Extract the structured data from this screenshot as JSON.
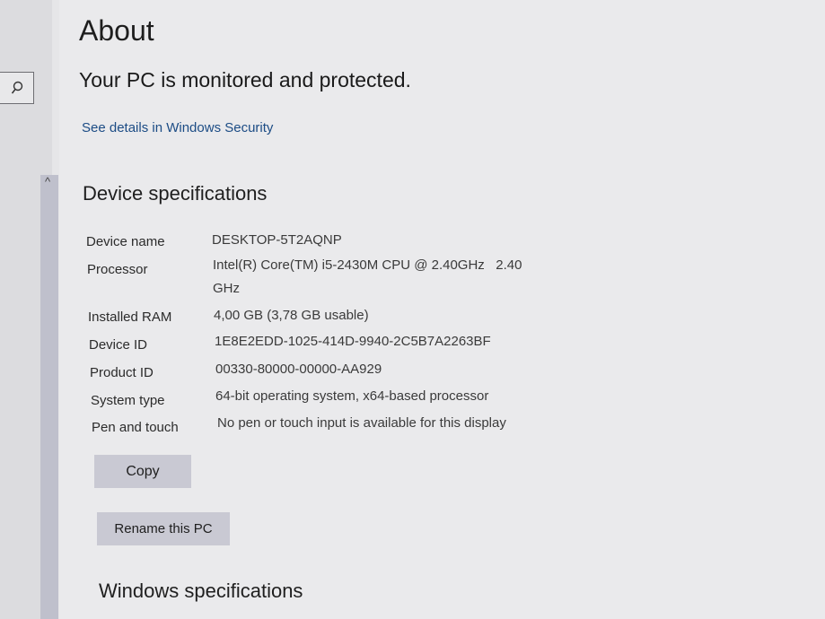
{
  "page": {
    "title": "About",
    "protection_status": "Your PC is monitored and protected.",
    "security_link": "See details in Windows Security"
  },
  "device_specs": {
    "heading": "Device specifications",
    "rows": [
      {
        "label": "Device name",
        "value": "DESKTOP-5T2AQNP"
      },
      {
        "label": "Processor",
        "value": "Intel(R) Core(TM) i5-2430M CPU @ 2.40GHz   2.40",
        "value_cont": "GHz"
      },
      {
        "label": "Installed RAM",
        "value": "4,00 GB (3,78 GB usable)"
      },
      {
        "label": "Device ID",
        "value": "1E8E2EDD-1025-414D-9940-2C5B7A2263BF"
      },
      {
        "label": "Product ID",
        "value": "00330-80000-00000-AA929"
      },
      {
        "label": "System type",
        "value": "64-bit operating system, x64-based processor"
      },
      {
        "label": "Pen and touch",
        "value": "No pen or touch input is available for this display"
      }
    ],
    "copy_button": "Copy"
  },
  "rename_button": "Rename this PC",
  "windows_specs": {
    "heading": "Windows specifications"
  },
  "icons": {
    "search": "search-icon",
    "scroll_up": "chevron-up-icon"
  }
}
